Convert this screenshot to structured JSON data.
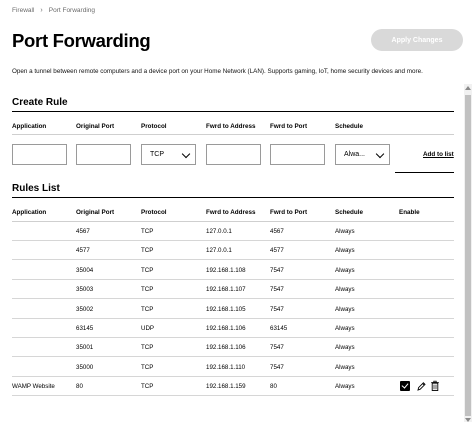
{
  "breadcrumb": {
    "items": [
      "Firewall",
      "Port Forwarding"
    ],
    "separator": "›"
  },
  "page": {
    "title": "Port Forwarding",
    "apply_label": "Apply Changes",
    "description": "Open a tunnel between remote computers and a device port on your Home Network (LAN). Supports gaming, IoT, home security devices and more."
  },
  "create_rule": {
    "title": "Create Rule",
    "headers": {
      "application": "Application",
      "original_port": "Original Port",
      "protocol": "Protocol",
      "fwrd_address": "Fwrd to Address",
      "fwrd_port": "Fwrd to Port",
      "schedule": "Schedule"
    },
    "inputs": {
      "application": "",
      "original_port": "",
      "fwrd_address": "",
      "fwrd_port": ""
    },
    "protocol_selected": "TCP",
    "schedule_selected": "Alwa...",
    "add_label": "Add to list"
  },
  "rules_list": {
    "title": "Rules List",
    "headers": {
      "application": "Application",
      "original_port": "Original Port",
      "protocol": "Protocol",
      "fwrd_address": "Fwrd to Address",
      "fwrd_port": "Fwrd to Port",
      "schedule": "Schedule",
      "enable": "Enable"
    },
    "rows": [
      {
        "application": "",
        "original_port": "4567",
        "protocol": "TCP",
        "fwrd_address": "127.0.0.1",
        "fwrd_port": "4567",
        "schedule": "Always",
        "editable": false
      },
      {
        "application": "",
        "original_port": "4577",
        "protocol": "TCP",
        "fwrd_address": "127.0.0.1",
        "fwrd_port": "4577",
        "schedule": "Always",
        "editable": false
      },
      {
        "application": "",
        "original_port": "35004",
        "protocol": "TCP",
        "fwrd_address": "192.168.1.108",
        "fwrd_port": "7547",
        "schedule": "Always",
        "editable": false
      },
      {
        "application": "",
        "original_port": "35003",
        "protocol": "TCP",
        "fwrd_address": "192.168.1.107",
        "fwrd_port": "7547",
        "schedule": "Always",
        "editable": false
      },
      {
        "application": "",
        "original_port": "35002",
        "protocol": "TCP",
        "fwrd_address": "192.168.1.105",
        "fwrd_port": "7547",
        "schedule": "Always",
        "editable": false
      },
      {
        "application": "",
        "original_port": "63145",
        "protocol": "UDP",
        "fwrd_address": "192.168.1.106",
        "fwrd_port": "63145",
        "schedule": "Always",
        "editable": false
      },
      {
        "application": "",
        "original_port": "35001",
        "protocol": "TCP",
        "fwrd_address": "192.168.1.106",
        "fwrd_port": "7547",
        "schedule": "Always",
        "editable": false
      },
      {
        "application": "",
        "original_port": "35000",
        "protocol": "TCP",
        "fwrd_address": "192.168.1.110",
        "fwrd_port": "7547",
        "schedule": "Always",
        "editable": false
      },
      {
        "application": "WAMP Website",
        "original_port": "80",
        "protocol": "TCP",
        "fwrd_address": "192.168.1.159",
        "fwrd_port": "80",
        "schedule": "Always",
        "editable": true,
        "enabled": true
      }
    ]
  },
  "icons": {
    "edit": "pencil-icon",
    "delete": "trash-icon",
    "enable": "checkbox-checked-icon",
    "dropdown": "chevron-down-icon"
  },
  "colors": {
    "apply_disabled_bg": "#d9d9d9",
    "text": "#000000",
    "muted": "#6b6b6b"
  }
}
